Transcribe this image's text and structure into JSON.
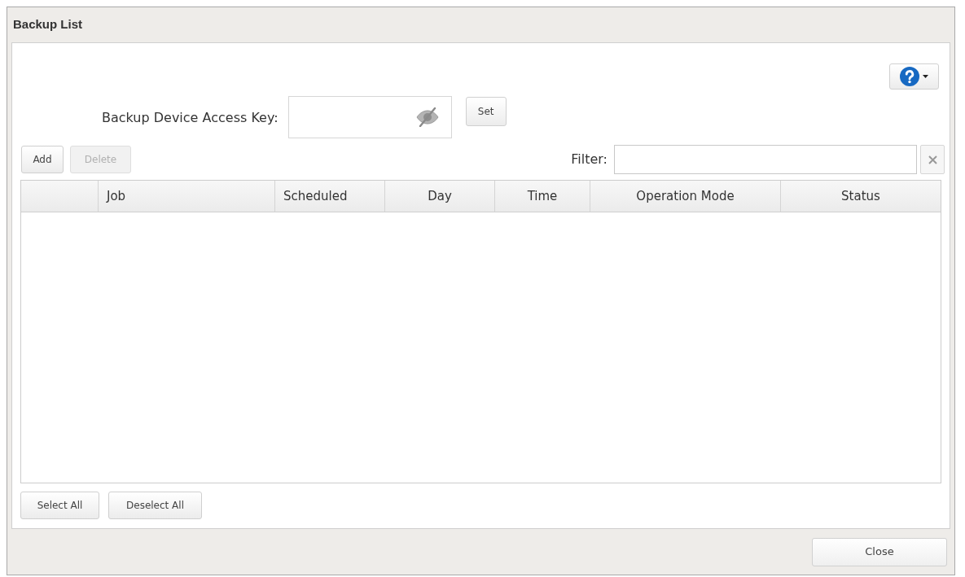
{
  "window": {
    "title": "Backup List"
  },
  "access_key": {
    "label": "Backup Device Access Key:",
    "button": "Set"
  },
  "toolbar": {
    "buttons": [
      {
        "label": "Add",
        "disabled": false
      },
      {
        "label": "Delete",
        "disabled": true
      }
    ],
    "filter_label": "Filter:"
  },
  "table": {
    "columns": [
      "Job",
      "Scheduled",
      "Day",
      "Time",
      "Operation Mode",
      "Status"
    ]
  },
  "selection_buttons": [
    "Select All",
    "Deselect All"
  ],
  "footer": {
    "buttons": [
      "Close"
    ]
  }
}
